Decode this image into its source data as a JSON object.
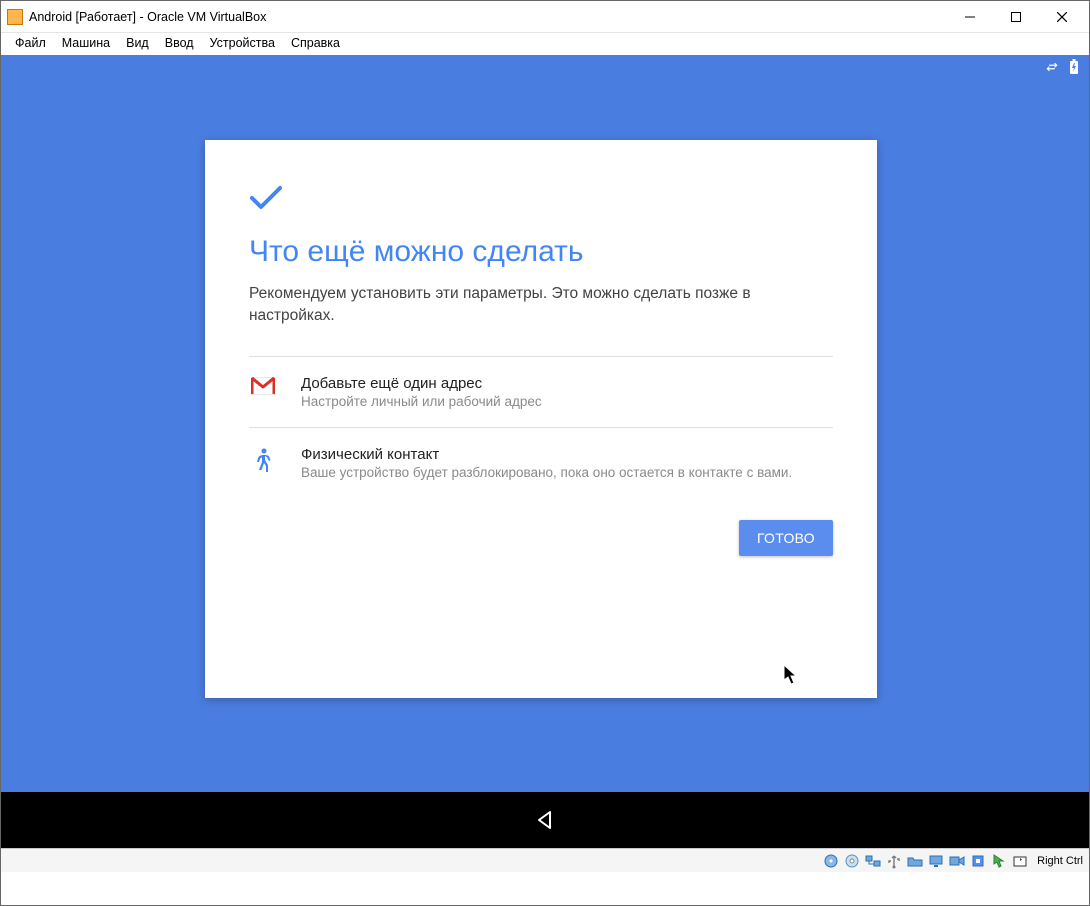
{
  "window": {
    "title": "Android [Работает] - Oracle VM VirtualBox"
  },
  "menu": {
    "file": "Файл",
    "machine": "Машина",
    "view": "Вид",
    "input": "Ввод",
    "devices": "Устройства",
    "help": "Справка"
  },
  "card": {
    "title": "Что ещё можно сделать",
    "subtitle": "Рекомендуем установить эти параметры. Это можно сделать позже в настройках.",
    "options": [
      {
        "icon": "gmail-icon",
        "title": "Добавьте ещё один адрес",
        "desc": "Настройте личный или рабочий адрес"
      },
      {
        "icon": "walking-icon",
        "title": "Физический контакт",
        "desc": "Ваше устройство будет разблокировано, пока оно остается в контакте с вами."
      }
    ],
    "done_label": "ГОТОВО"
  },
  "statusbar": {
    "host_key": "Right Ctrl"
  },
  "colors": {
    "vm_bg": "#4a7de0",
    "accent": "#4285f4",
    "button": "#5b8def"
  }
}
